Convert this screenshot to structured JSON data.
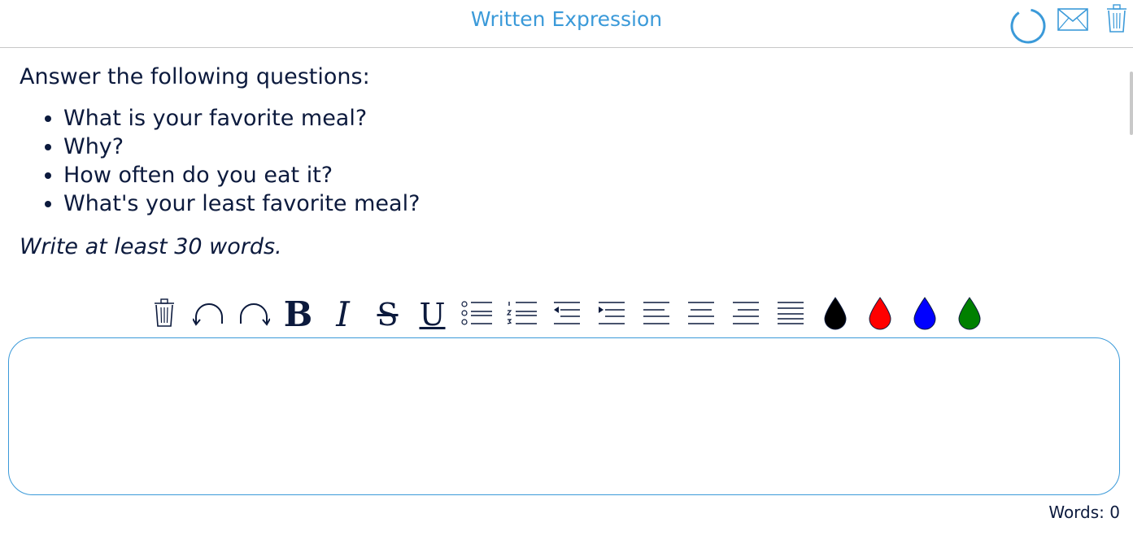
{
  "header": {
    "title": "Written Expression",
    "icons": [
      "progress-spinner-icon",
      "mail-icon",
      "trash-icon"
    ],
    "accent_color": "#3b9ad9"
  },
  "prompt": {
    "instruction": "Answer the following questions:",
    "questions": [
      "What is your favorite meal?",
      "Why?",
      "How often do you eat it?",
      "What's your least favorite meal?"
    ],
    "note": "Write at least 30 words."
  },
  "toolbar": {
    "bold_label": "B",
    "italic_label": "I",
    "strike_label": "S",
    "underline_label": "U",
    "icons": [
      "trash-icon",
      "undo-icon",
      "redo-icon",
      "bold-icon",
      "italic-icon",
      "strikethrough-icon",
      "underline-icon",
      "bullet-list-icon",
      "numbered-list-icon",
      "outdent-icon",
      "indent-icon",
      "align-left-icon",
      "align-center-icon",
      "align-right-icon",
      "align-justify-icon",
      "color-black-icon",
      "color-red-icon",
      "color-blue-icon",
      "color-green-icon"
    ],
    "colors": {
      "black": "#000000",
      "red": "#ff0000",
      "blue": "#0000ff",
      "green": "#008000"
    }
  },
  "editor": {
    "value": ""
  },
  "footer": {
    "word_count": "Words: 0"
  }
}
